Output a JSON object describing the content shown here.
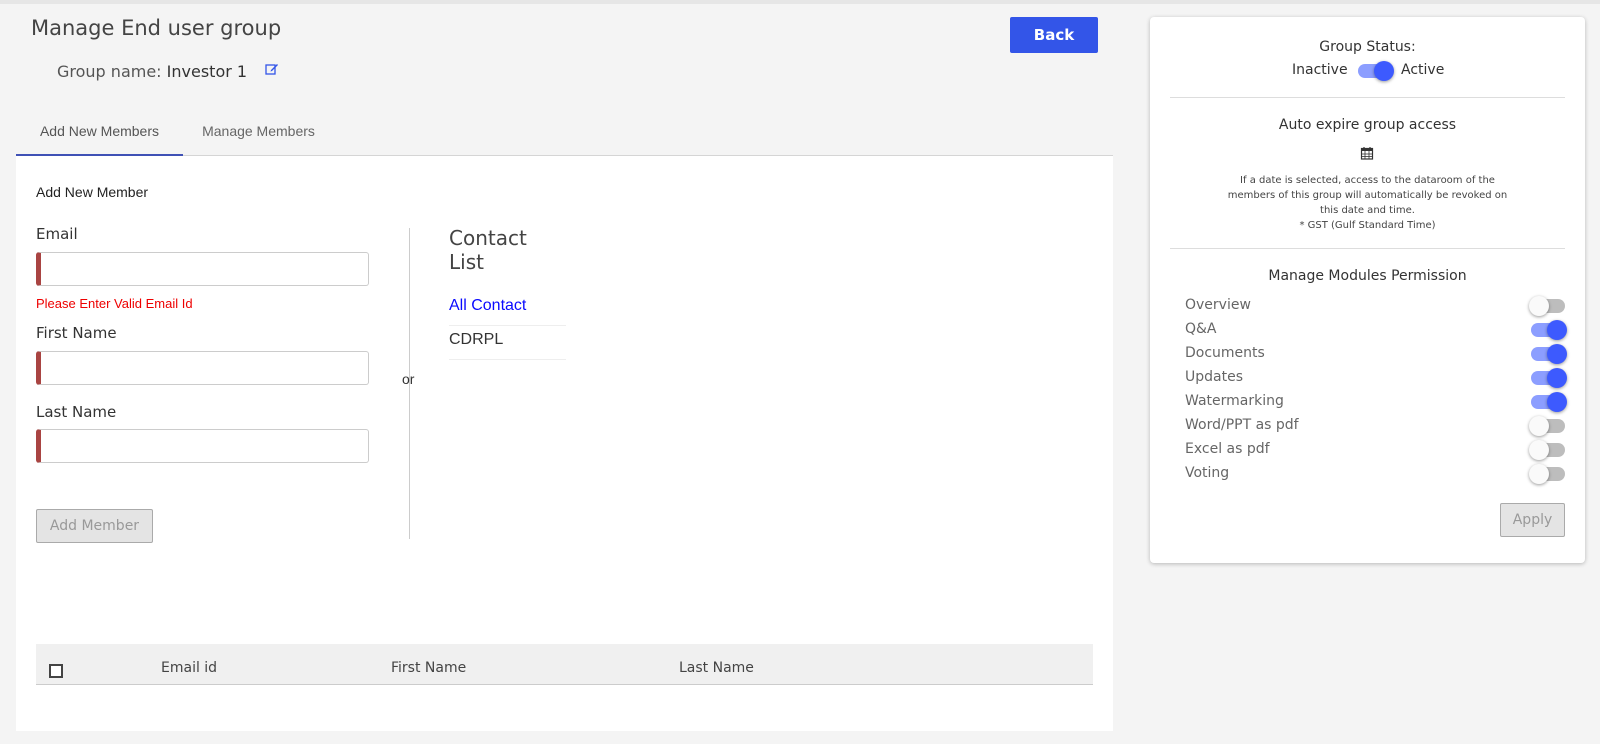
{
  "header": {
    "title": "Manage End user group",
    "group_name_label": "Group name:",
    "group_name_value": "Investor 1",
    "back_label": "Back"
  },
  "tabs": [
    {
      "label": "Add New Members",
      "active": true
    },
    {
      "label": "Manage Members",
      "active": false
    }
  ],
  "form": {
    "section_title": "Add New Member",
    "email_label": "Email",
    "email_value": "",
    "email_error": "Please Enter Valid Email Id",
    "first_name_label": "First Name",
    "first_name_value": "",
    "last_name_label": "Last Name",
    "last_name_value": "",
    "add_button": "Add Member",
    "or_text": "or"
  },
  "contact_list": {
    "title": "Contact List",
    "items": [
      "All Contact",
      "CDRPL"
    ]
  },
  "table": {
    "columns": [
      "Email id",
      "First Name",
      "Last Name"
    ],
    "rows": []
  },
  "right_panel": {
    "status_title": "Group Status:",
    "inactive_label": "Inactive",
    "active_label": "Active",
    "status_active": true,
    "auto_expire_title": "Auto expire group access",
    "auto_expire_desc": "If a date is selected, access to the dataroom of the members of this group will automatically be revoked on this date and time.",
    "timezone_note": "* GST (Gulf Standard Time)",
    "permissions_title": "Manage Modules Permission",
    "permissions": [
      {
        "label": "Overview",
        "enabled": false
      },
      {
        "label": "Q&A",
        "enabled": true
      },
      {
        "label": "Documents",
        "enabled": true
      },
      {
        "label": "Updates",
        "enabled": true
      },
      {
        "label": "Watermarking",
        "enabled": true
      },
      {
        "label": "Word/PPT as pdf",
        "enabled": false
      },
      {
        "label": "Excel as pdf",
        "enabled": false
      },
      {
        "label": "Voting",
        "enabled": false
      }
    ],
    "apply_label": "Apply"
  },
  "colors": {
    "primary": "#3355e8",
    "tab_indicator": "#3f51b5",
    "toggle_on_knob": "#3d5afe",
    "toggle_on_track": "#8c9eff",
    "error": "#e00000",
    "link": "#0a0aff",
    "invalid_border": "#a94442"
  },
  "icons": {
    "edit": "edit-icon",
    "calendar": "calendar-icon"
  }
}
